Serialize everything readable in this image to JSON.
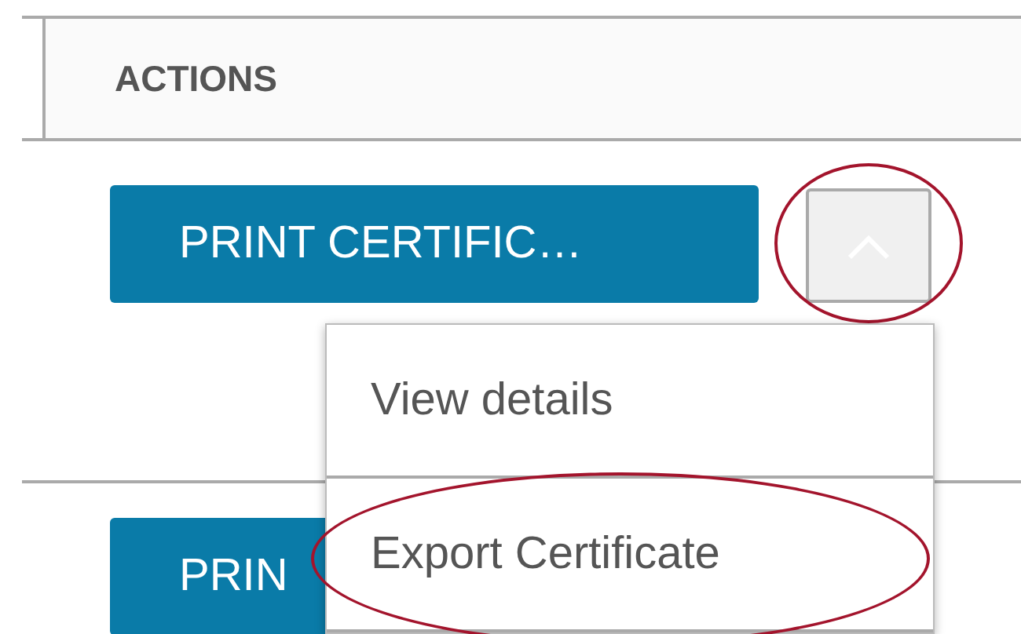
{
  "table": {
    "columns": [
      {
        "label": "ACTIONS"
      }
    ],
    "rows": [
      {
        "action_label": "PRINT CERTIFIC…",
        "menu_toggle": {
          "expanded": true,
          "highlighted": true
        }
      },
      {
        "action_label": "PRIN"
      }
    ]
  },
  "dropdown_menu": {
    "items": [
      {
        "label": "View details",
        "highlighted": false
      },
      {
        "label": "Export Certificate",
        "highlighted": true
      }
    ]
  }
}
